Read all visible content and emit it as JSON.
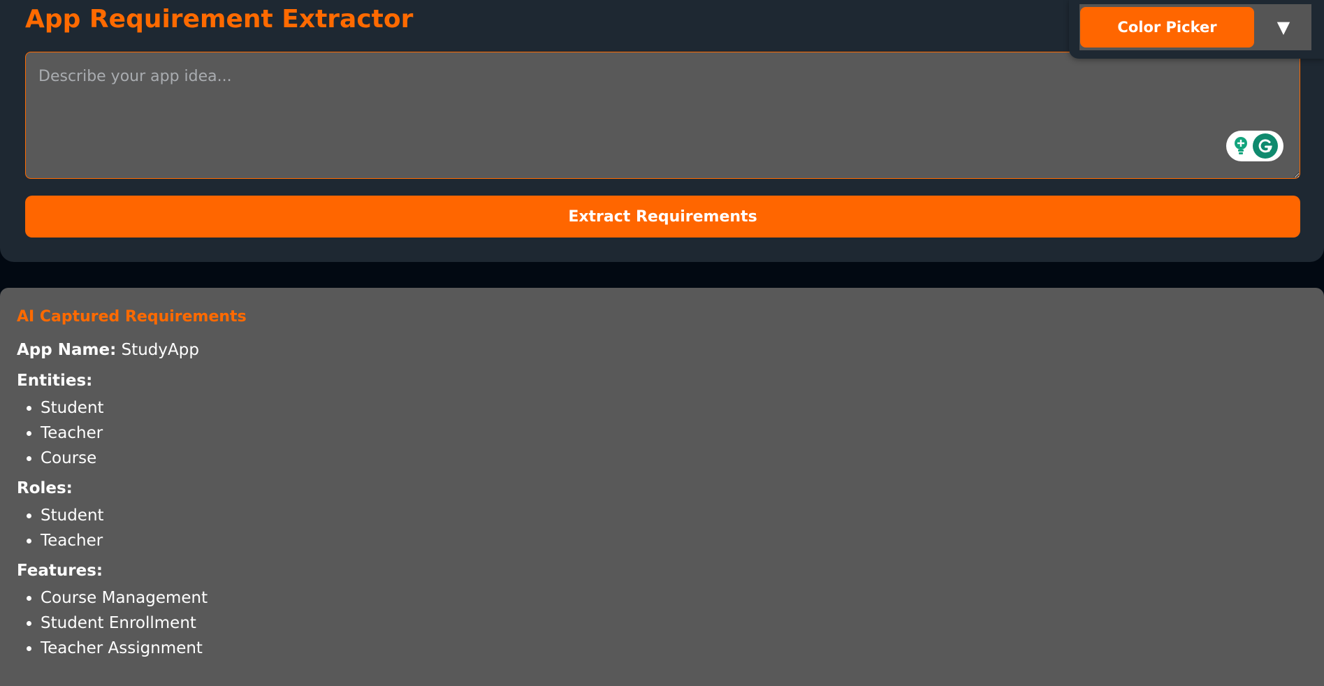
{
  "header": {
    "title": "App Requirement Extractor"
  },
  "idea_input": {
    "value": "",
    "placeholder": "Describe your app idea..."
  },
  "extract_button": {
    "label": "Extract Requirements"
  },
  "color_picker": {
    "label": "Color Picker",
    "arrow": "▼"
  },
  "results": {
    "heading": "AI Captured Requirements",
    "app_name_label": "App Name:",
    "app_name_value": "StudyApp",
    "entities_label": "Entities:",
    "entities": [
      "Student",
      "Teacher",
      "Course"
    ],
    "roles_label": "Roles:",
    "roles": [
      "Student",
      "Teacher"
    ],
    "features_label": "Features:",
    "features": [
      "Course Management",
      "Student Enrollment",
      "Teacher Assignment"
    ]
  },
  "colors": {
    "accent": "#ff6600",
    "panel_dark": "#1e2832",
    "panel_grey": "#595959",
    "page_bg": "#020912"
  },
  "icons": {
    "grammarly_bulb": "lightbulb-plus-icon",
    "grammarly_logo": "grammarly-g-icon",
    "dropdown": "chevron-down-icon"
  }
}
